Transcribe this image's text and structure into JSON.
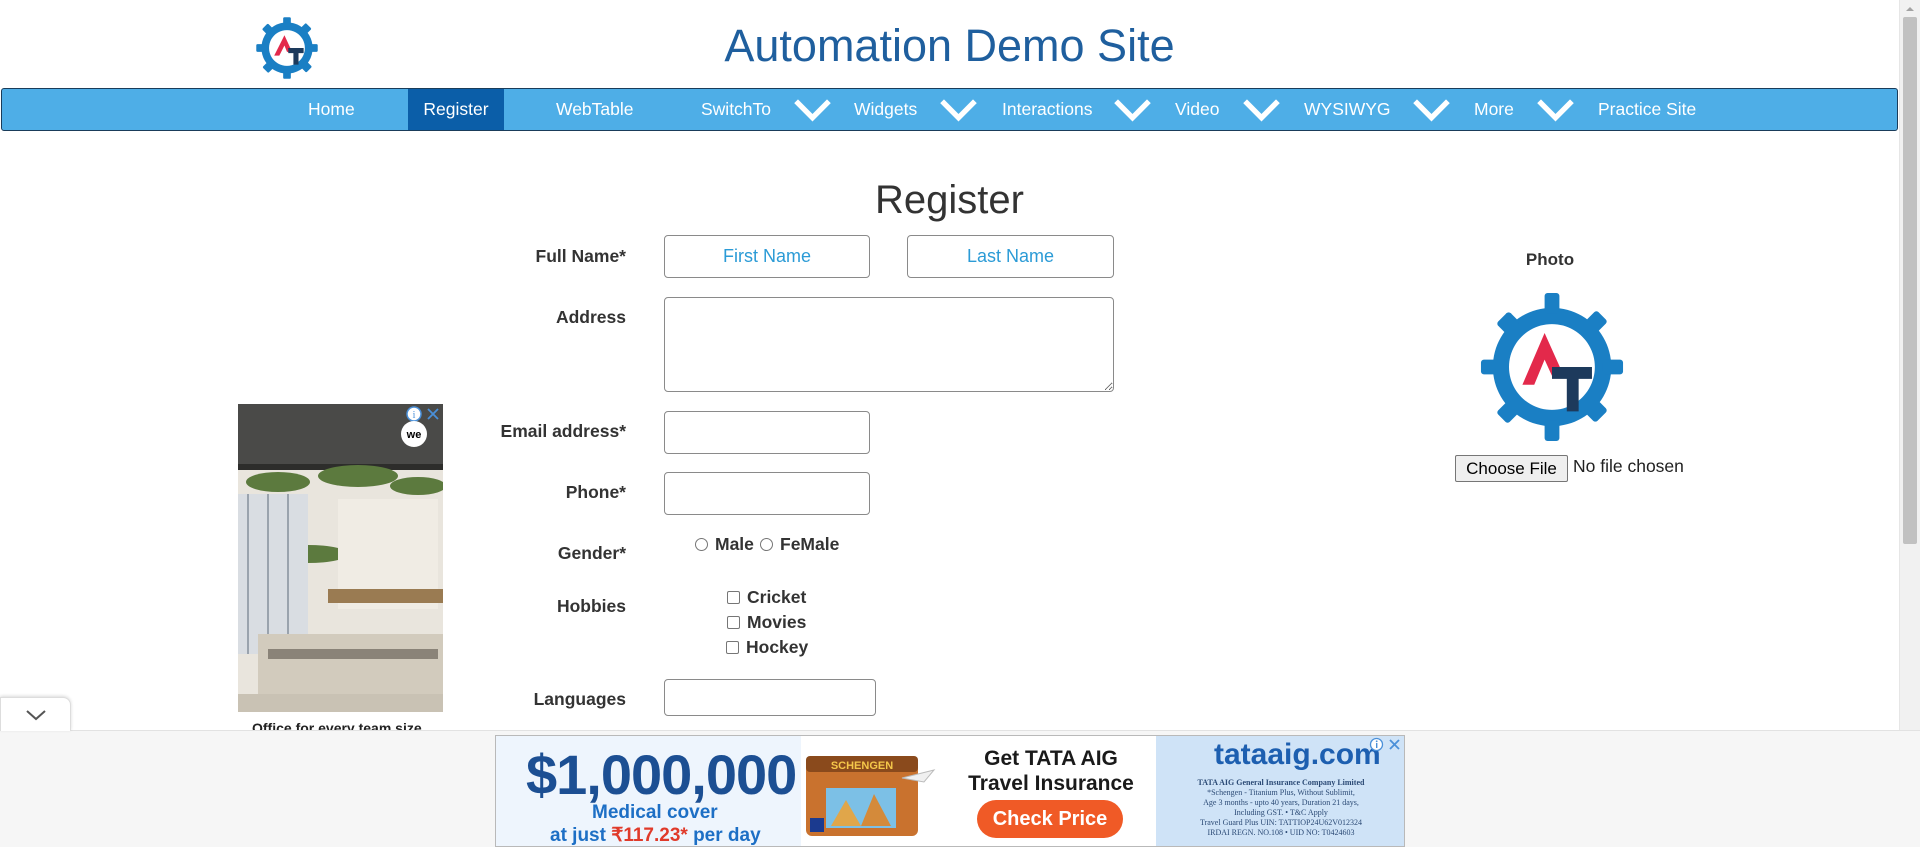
{
  "header": {
    "title": "Automation Demo Site"
  },
  "nav": {
    "items": [
      {
        "label": "Home"
      },
      {
        "label": "Register"
      },
      {
        "label": "WebTable"
      },
      {
        "label": "SwitchTo"
      },
      {
        "label": "Widgets"
      },
      {
        "label": "Interactions"
      },
      {
        "label": "Video"
      },
      {
        "label": "WYSIWYG"
      },
      {
        "label": "More"
      },
      {
        "label": "Practice Site"
      }
    ],
    "active": "Register"
  },
  "form": {
    "title": "Register",
    "full_name_label": "Full Name*",
    "first_name_placeholder": "First Name",
    "last_name_placeholder": "Last Name",
    "address_label": "Address",
    "email_label": "Email address*",
    "phone_label": "Phone*",
    "gender_label": "Gender*",
    "gender_options": [
      "Male",
      "FeMale"
    ],
    "hobbies_label": "Hobbies",
    "hobbies": [
      "Cricket",
      "Movies",
      "Hockey"
    ],
    "languages_label": "Languages"
  },
  "photo": {
    "label": "Photo",
    "button": "Choose File",
    "status": "No file chosen"
  },
  "side_ad": {
    "caption": "Office for every team size"
  },
  "bottom_ad": {
    "amount": "$1,000,000",
    "sub1": "Medical cover",
    "sub2_prefix": "at just ",
    "sub2_price": "₹117.23*",
    "sub2_suffix": " per day",
    "suitcase_text": "SCHENGEN",
    "headline": "Get TATA AIG Travel Insurance",
    "cta": "Check Price",
    "brand": "tataaig.com",
    "fine_title": "TATA AIG General Insurance Company Limited",
    "fine_1": "*Schengen - Titanium Plus, Without Sublimit,",
    "fine_2": "Age 3 months - upto 40 years, Duration 21 days,",
    "fine_3": "Including GST. • T&C Apply",
    "fine_4": "Travel Guard Plus UIN: TATTIOP24U62V012324",
    "fine_5": "IRDAI REGN. NO.108 • UID NO: T0424603"
  },
  "colors": {
    "nav_bg": "#4eaee7",
    "nav_active": "#0b5ea8",
    "title": "#1f5f9e",
    "placeholder": "#2b9bd6",
    "logo_blue": "#1a7fc4",
    "logo_red": "#e3294b",
    "logo_navy": "#1d3a5c"
  },
  "icons": {
    "logo": "automation-testing-gear-logo",
    "nav_dropdown": "chevron-down-icon",
    "ad_info": "info-icon",
    "ad_close": "close-icon",
    "collapse": "chevron-down-icon"
  }
}
